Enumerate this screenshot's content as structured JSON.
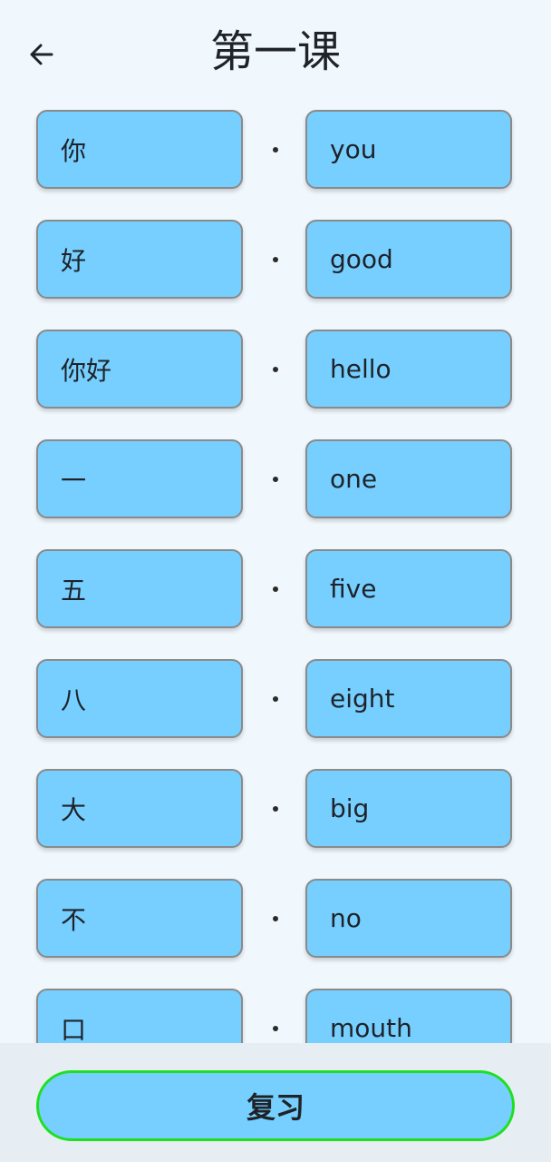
{
  "header": {
    "title": "第一课",
    "back_icon": "arrow-left-icon"
  },
  "vocab": [
    {
      "zh": "你",
      "en": "you"
    },
    {
      "zh": "好",
      "en": "good"
    },
    {
      "zh": "你好",
      "en": "hello"
    },
    {
      "zh": "一",
      "en": "one"
    },
    {
      "zh": "五",
      "en": "five"
    },
    {
      "zh": "八",
      "en": "eight"
    },
    {
      "zh": "大",
      "en": "big"
    },
    {
      "zh": "不",
      "en": "no"
    },
    {
      "zh": "口",
      "en": "mouth"
    }
  ],
  "footer": {
    "review_label": "复习"
  },
  "colors": {
    "background": "#f1f8fd",
    "card": "#76cfff",
    "card_border": "#8a8a8a",
    "review_border": "#1fe01f",
    "footer_bg": "#e6edf3"
  }
}
